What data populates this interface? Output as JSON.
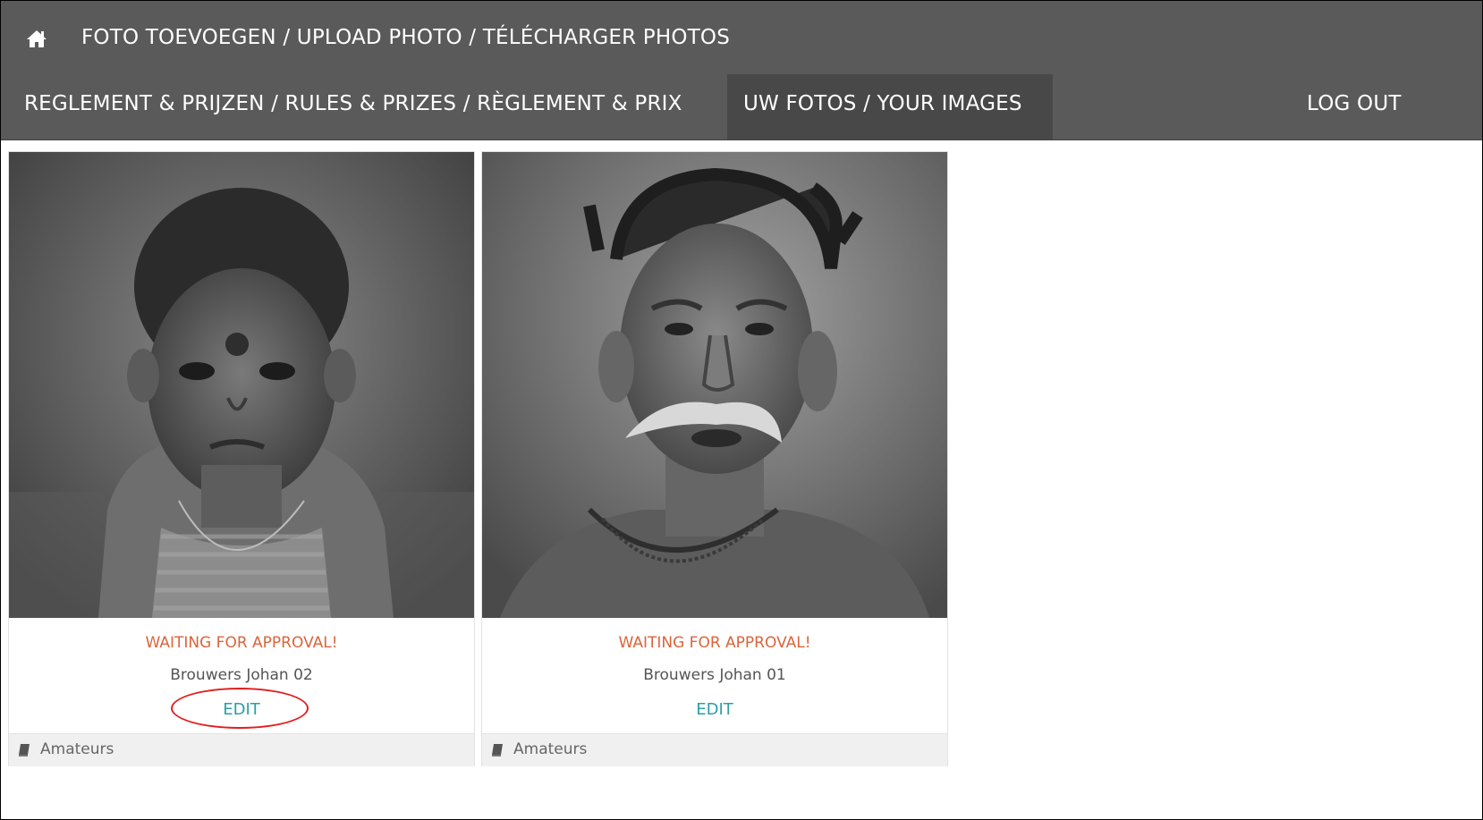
{
  "nav": {
    "home_icon": "home-icon",
    "upload_label": "FOTO TOEVOEGEN / UPLOAD PHOTO / TÉLÉCHARGER PHOTOS",
    "rules_label": "REGLEMENT & PRIJZEN / RULES & PRIZES / RÈGLEMENT & PRIX",
    "images_label": "UW FOTOS / YOUR IMAGES",
    "logout_label": "LOG OUT"
  },
  "colors": {
    "navbar": "#5a5a5a",
    "active_nav": "#484848",
    "status": "#d9653b",
    "edit_link": "#2aa0a4",
    "annotation": "#e02020"
  },
  "photos": [
    {
      "status": "WAITING FOR APPROVAL!",
      "title": "Brouwers Johan 02",
      "edit_label": "EDIT",
      "category_icon": "book-icon",
      "category": "Amateurs"
    },
    {
      "status": "WAITING FOR APPROVAL!",
      "title": "Brouwers Johan 01",
      "edit_label": "EDIT",
      "category_icon": "book-icon",
      "category": "Amateurs"
    }
  ]
}
